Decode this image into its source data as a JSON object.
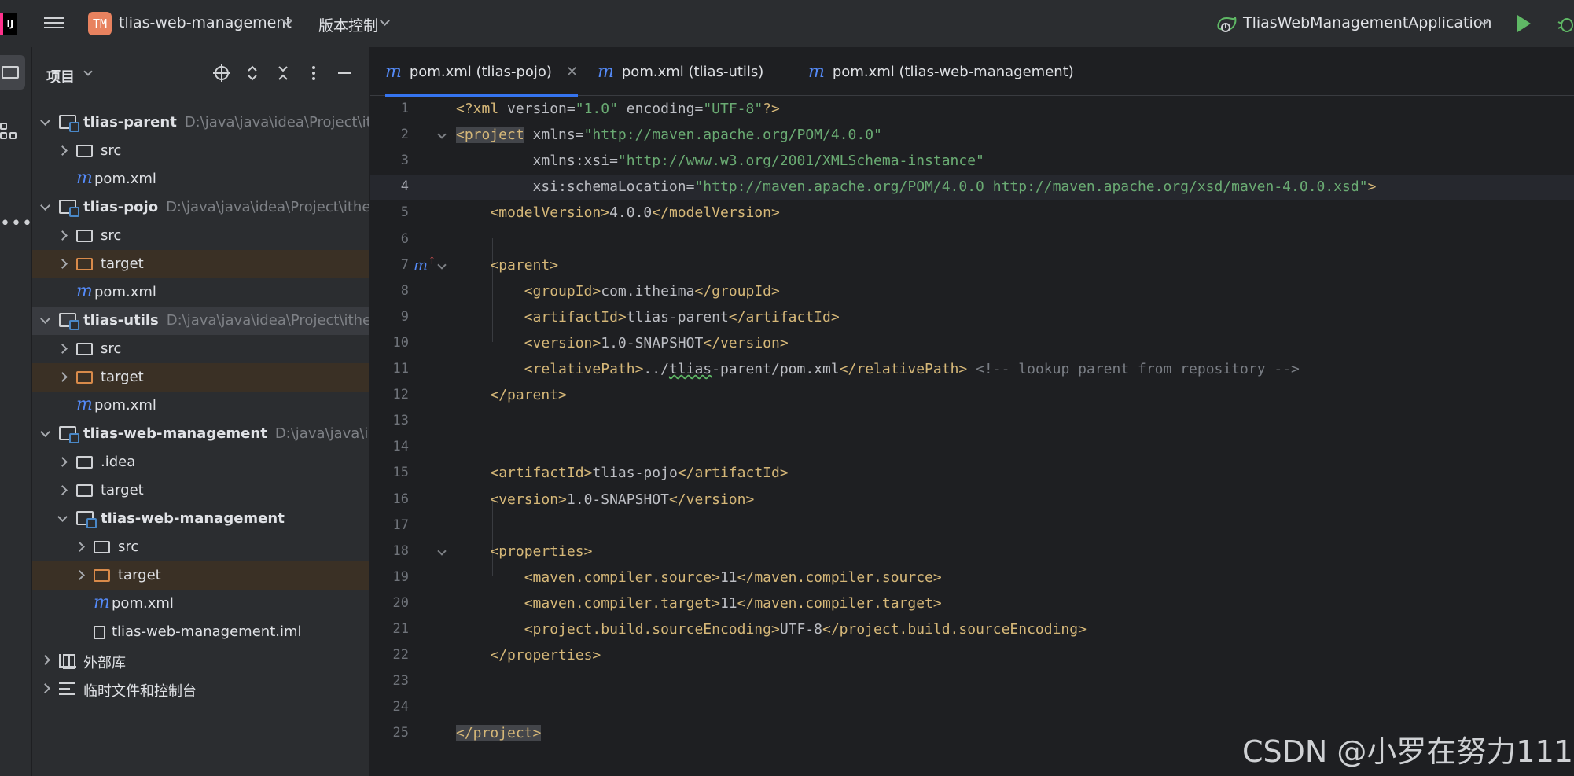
{
  "titlebar": {
    "logo_text": "IJ",
    "project_badge": "TM",
    "project_name": "tlias-web-management",
    "vcs_label": "版本控制",
    "run_config": "TliasWebManagementApplication"
  },
  "panel": {
    "title": "项目",
    "tree": [
      {
        "label": "tlias-parent",
        "path": "D:\\java\\java\\idea\\Project\\ith",
        "icon": "module",
        "bold": true,
        "level": 0,
        "chevron": "down"
      },
      {
        "label": "src",
        "icon": "folder",
        "level": 1,
        "chevron": "right"
      },
      {
        "label": "pom.xml",
        "icon": "maven",
        "level": 1
      },
      {
        "label": "tlias-pojo",
        "path": "D:\\java\\java\\idea\\Project\\ithei",
        "icon": "module",
        "bold": true,
        "level": 0,
        "chevron": "down"
      },
      {
        "label": "src",
        "icon": "folder",
        "level": 1,
        "chevron": "right"
      },
      {
        "label": "target",
        "icon": "folder-orange",
        "level": 1,
        "chevron": "right",
        "highlight": "orange"
      },
      {
        "label": "pom.xml",
        "icon": "maven",
        "level": 1
      },
      {
        "label": "tlias-utils",
        "path": "D:\\java\\java\\idea\\Project\\ithei",
        "icon": "module",
        "bold": true,
        "level": 0,
        "chevron": "down",
        "highlight": "selected"
      },
      {
        "label": "src",
        "icon": "folder",
        "level": 1,
        "chevron": "right"
      },
      {
        "label": "target",
        "icon": "folder-orange",
        "level": 1,
        "chevron": "right",
        "highlight": "orange"
      },
      {
        "label": "pom.xml",
        "icon": "maven",
        "level": 1
      },
      {
        "label": "tlias-web-management",
        "path": "D:\\java\\java\\ide",
        "icon": "module",
        "bold": true,
        "level": 0,
        "chevron": "down"
      },
      {
        "label": ".idea",
        "icon": "folder",
        "level": 1,
        "chevron": "right"
      },
      {
        "label": "target",
        "icon": "folder",
        "level": 1,
        "chevron": "right"
      },
      {
        "label": "tlias-web-management",
        "icon": "module",
        "bold": true,
        "level": 1,
        "chevron": "down"
      },
      {
        "label": "src",
        "icon": "folder",
        "level": 2,
        "chevron": "right"
      },
      {
        "label": "target",
        "icon": "folder-orange",
        "level": 2,
        "chevron": "right",
        "highlight": "orange"
      },
      {
        "label": "pom.xml",
        "icon": "maven",
        "level": 2
      },
      {
        "label": "tlias-web-management.iml",
        "icon": "iml",
        "level": 2
      },
      {
        "label": "外部库",
        "icon": "library",
        "level": 0,
        "chevron": "right"
      },
      {
        "label": "临时文件和控制台",
        "icon": "scratch",
        "level": 0,
        "chevron": "right"
      }
    ]
  },
  "editor": {
    "tabs": [
      {
        "label": "pom.xml (tlias-pojo)",
        "active": true,
        "closable": true
      },
      {
        "label": "pom.xml (tlias-utils)",
        "active": false
      },
      {
        "label": "pom.xml (tlias-web-management)",
        "active": false
      }
    ],
    "current_line": 4,
    "lines": [
      "<?xml version=\"1.0\" encoding=\"UTF-8\"?>",
      "<project xmlns=\"http://maven.apache.org/POM/4.0.0\"",
      "         xmlns:xsi=\"http://www.w3.org/2001/XMLSchema-instance\"",
      "         xsi:schemaLocation=\"http://maven.apache.org/POM/4.0.0 http://maven.apache.org/xsd/maven-4.0.0.xsd\">",
      "    <modelVersion>4.0.0</modelVersion>",
      "",
      "    <parent>",
      "        <groupId>com.itheima</groupId>",
      "        <artifactId>tlias-parent</artifactId>",
      "        <version>1.0-SNAPSHOT</version>",
      "        <relativePath>../tlias-parent/pom.xml</relativePath> <!-- lookup parent from repository -->",
      "    </parent>",
      "",
      "",
      "    <artifactId>tlias-pojo</artifactId>",
      "    <version>1.0-SNAPSHOT</version>",
      "",
      "    <properties>",
      "        <maven.compiler.source>11</maven.compiler.source>",
      "        <maven.compiler.target>11</maven.compiler.target>",
      "        <project.build.sourceEncoding>UTF-8</project.build.sourceEncoding>",
      "    </properties>",
      "",
      "",
      "</project>"
    ],
    "fold_lines": [
      2,
      7,
      18
    ],
    "maven_gutter_line": 7
  },
  "watermark": "CSDN @小罗在努力111",
  "colors": {
    "accent": "#3574f0",
    "tag": "#d5b778",
    "string": "#6aab73",
    "namespace": "#c77dbb",
    "comment": "#7a7e85",
    "target_folder": "#d88a4a"
  }
}
